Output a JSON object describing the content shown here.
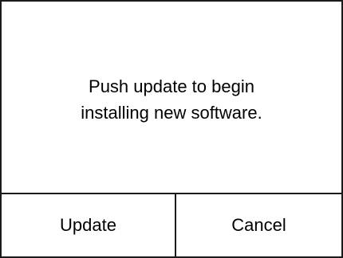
{
  "dialog": {
    "message_line_1": "Push update to begin",
    "message_line_2": "installing new software.",
    "update_label": "Update",
    "cancel_label": "Cancel"
  },
  "colors": {
    "border": "#1a1a1a",
    "background": "#ffffff",
    "text": "#000000"
  }
}
